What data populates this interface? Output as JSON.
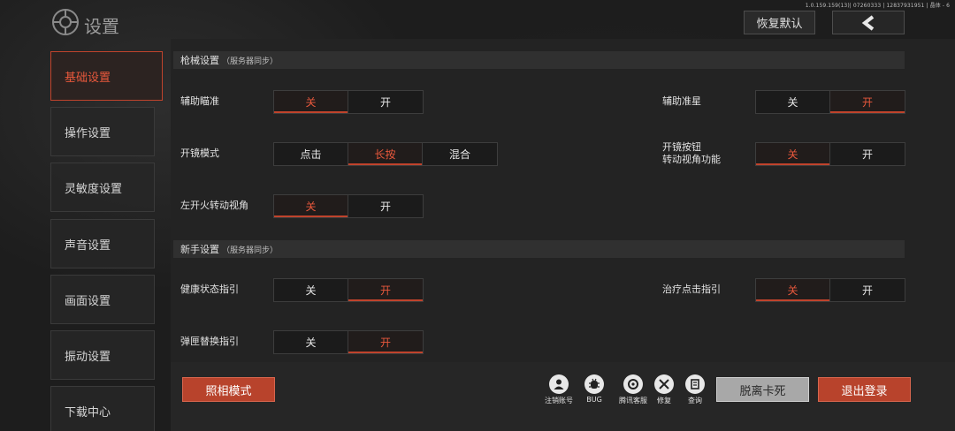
{
  "version": "1.0.159.159(13)| 07260333 | 12837931951 | 晶体 - 6",
  "header": {
    "title": "设置",
    "restore_label": "恢复默认"
  },
  "sidebar": {
    "items": [
      {
        "label": "基础设置",
        "active": true
      },
      {
        "label": "操作设置",
        "active": false
      },
      {
        "label": "灵敏度设置",
        "active": false
      },
      {
        "label": "声音设置",
        "active": false
      },
      {
        "label": "画面设置",
        "active": false
      },
      {
        "label": "振动设置",
        "active": false
      },
      {
        "label": "下载中心",
        "active": false
      }
    ]
  },
  "sections": {
    "gun": {
      "title": "枪械设置",
      "sub": "（服务器同步）"
    },
    "newbie": {
      "title": "新手设置",
      "sub": "（服务器同步）"
    }
  },
  "settings": {
    "aim_assist": {
      "label": "辅助瞄准",
      "options": [
        "关",
        "开"
      ],
      "selected": "关"
    },
    "aim_crosshair": {
      "label": "辅助准星",
      "options": [
        "关",
        "开"
      ],
      "selected": "开"
    },
    "scope_mode": {
      "label": "开镜模式",
      "options": [
        "点击",
        "长按",
        "混合"
      ],
      "selected": "长按"
    },
    "scope_button_line1": "开镜按钮",
    "scope_button_line2": "转动视角功能",
    "scope_button": {
      "options": [
        "关",
        "开"
      ],
      "selected": "关"
    },
    "left_fire": {
      "label": "左开火转动视角",
      "options": [
        "关",
        "开"
      ],
      "selected": "关"
    },
    "health_guide": {
      "label": "健康状态指引",
      "options": [
        "关",
        "开"
      ],
      "selected": "开"
    },
    "heal_guide": {
      "label": "治疗点击指引",
      "options": [
        "关",
        "开"
      ],
      "selected": "关"
    },
    "mag_guide": {
      "label": "弹匣替换指引",
      "options": [
        "关",
        "开"
      ],
      "selected": "开"
    }
  },
  "bottom": {
    "photo_label": "照相模式",
    "tools": [
      {
        "label": "注销账号",
        "icon": "user-icon"
      },
      {
        "label": "BUG",
        "icon": "bug-icon"
      },
      {
        "label": "腾讯客服",
        "icon": "support-icon"
      },
      {
        "label": "修复",
        "icon": "repair-icon"
      },
      {
        "label": "查询",
        "icon": "query-icon"
      }
    ],
    "stuck_label": "脱离卡死",
    "logout_label": "退出登录"
  }
}
